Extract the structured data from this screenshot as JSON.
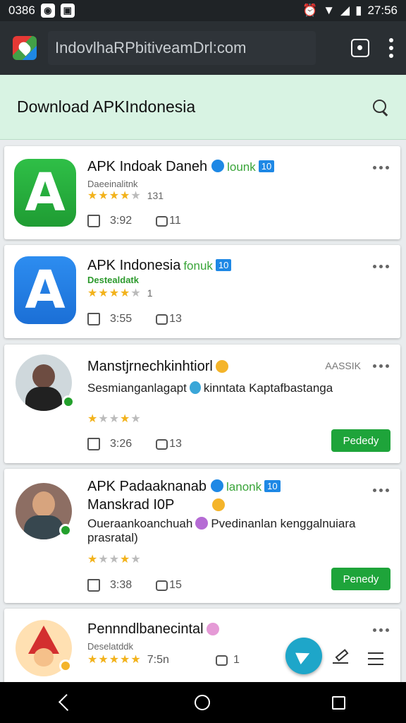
{
  "status_bar": {
    "time_left": "0386",
    "time_right": "27:56"
  },
  "browser": {
    "url": "IndovlhaRPbitiveamDrl:com"
  },
  "page": {
    "title": "Download APKIndonesia"
  },
  "cards": [
    {
      "title": "APK Indoak Daneh",
      "tag_green": "lounk",
      "tag_blue": "10",
      "subtitle": "Daeeinalitnk",
      "rating": 3.5,
      "rating_count": "131",
      "likes": "3:92",
      "comments": "11"
    },
    {
      "title": "APK Indonesia",
      "tag_green": "fonuk",
      "tag_blue": "10",
      "subtitle": "Destealdatk",
      "rating": 4.5,
      "rating_count": "1",
      "likes": "3:55",
      "comments": "13"
    },
    {
      "title": "Manstjrnechkinhtiorl",
      "ad_label": "AASSIK",
      "description_a": "Sesmianganlagapt",
      "description_b": "kinntata Kaptafbastanga",
      "rating": 3,
      "likes": "3:26",
      "comments": "13",
      "button": "Pededy"
    },
    {
      "title": "APK Padaaknanab",
      "title2": "Manskrad I0P",
      "tag_green": "lanonk",
      "tag_blue": "10",
      "description_a": "Oueraankoanchuah",
      "description_b": "Pvedinanlan kenggalnuiara",
      "description_c": "prasratal)",
      "rating": 3,
      "likes": "3:38",
      "comments": "15",
      "button": "Penedy"
    },
    {
      "title": "Pennndlbanecintal",
      "subtitle": "Deselatddk",
      "rating": 5,
      "rating_count": "7:5n",
      "comments": "1"
    }
  ],
  "colors": {
    "accent_green": "#1ea43a",
    "header_bg": "#d8f3e3",
    "fab": "#1ea6c9",
    "verified_blue": "#1e88e5"
  },
  "icons": [
    "search-icon",
    "more-icon",
    "thumb-up-icon",
    "comment-icon",
    "send-icon",
    "edit-icon",
    "list-icon",
    "back-icon",
    "home-icon",
    "recents-icon"
  ]
}
